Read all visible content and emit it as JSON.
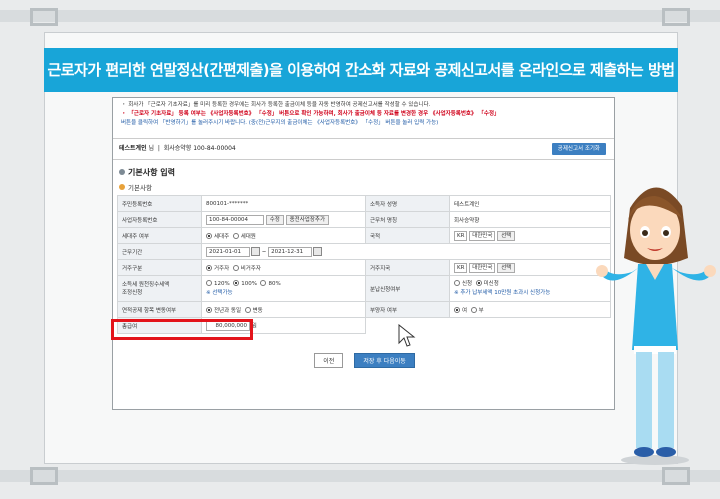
{
  "title": "근로자가 편리한 연말정산(간편제출)을 이용하여 간소화 자료와 공제신고서를 온라인으로 제출하는 방법",
  "notice": {
    "line1": "・ 회사가 「근로자 기초자료」를 미리 등록한 경우에는 회사가 등록한 출금이체 등을 자동 반영하여 공제신고서를 작성할 수 있습니다.",
    "line2": "・ 「근로자 기초자료」 등록 여부는 《사업자등록번호》 「수정」 버튼으로 확인 가능하며, 회사가 출금이체 등 자료를 변경한 경우 《사업자등록번호》 「수정」",
    "line3": "버튼을 클릭하여 「반영하기」를 눌러주시기 바랍니다. (중(전)근무지의 출금이체는 《사업자등록번호》 「수정」 버튼을 눌러 입력 가능)"
  },
  "company": {
    "name": "테스트계인",
    "suffix": "님",
    "info": "회사승약향 100-84-00004",
    "button": "공제신고서 조기화"
  },
  "section_title": "기본사항 입력",
  "sub_title": "기본사항",
  "form": {
    "resident_label": "주민등록번호",
    "resident_value": "800101-*******",
    "company_name_label": "소득자 성명",
    "company_name_value": "테스트계인",
    "bizno_label": "사업자등록번호",
    "bizno_value": "100-84-00004",
    "edit_btn": "수정",
    "add_btn": "종전사업장추가",
    "workplace_label": "근무처 명칭",
    "workplace_value": "회사승약향",
    "household_label": "세대주 여부",
    "household_opt1": "세대주",
    "household_opt2": "세대원",
    "nation_label": "국적",
    "nation_code": "KR",
    "nation_name": "대한민국",
    "select_btn": "선택",
    "period_label": "근무기간",
    "period_from": "2021-01-01",
    "period_to": "2021-12-31",
    "residency_label": "거주구분",
    "residency_opt1": "거주자",
    "residency_opt2": "비거주자",
    "country_label": "거주지국",
    "country_code": "KR",
    "country_name": "대한민국",
    "tax_label1": "소득세 원천징수세액",
    "tax_label2": "조정신청",
    "tax_opt1": "120%",
    "tax_opt2": "100%",
    "tax_opt3": "80%",
    "tax_hint": "※ 선택가능",
    "split_label": "분납신청여부",
    "split_opt1": "신청",
    "split_opt2": "미신청",
    "split_hint": "※ 추가 납부세액 10만원 초과시 신청가능",
    "change_label": "연적공제 항목 변동여부",
    "change_opt1": "전년과 동일",
    "change_opt2": "변동",
    "spouse_label": "부양자 여부",
    "spouse_opt1": "여",
    "spouse_opt2": "부",
    "salary_label": "총급여",
    "salary_value": "80,000,000",
    "salary_unit": "원"
  },
  "buttons": {
    "prev": "이전",
    "next": "저장 후 다음이동"
  },
  "colors": {
    "title_bar": "#18a5d8",
    "highlight": "#e3141b",
    "primary_button": "#3c7fc1"
  }
}
